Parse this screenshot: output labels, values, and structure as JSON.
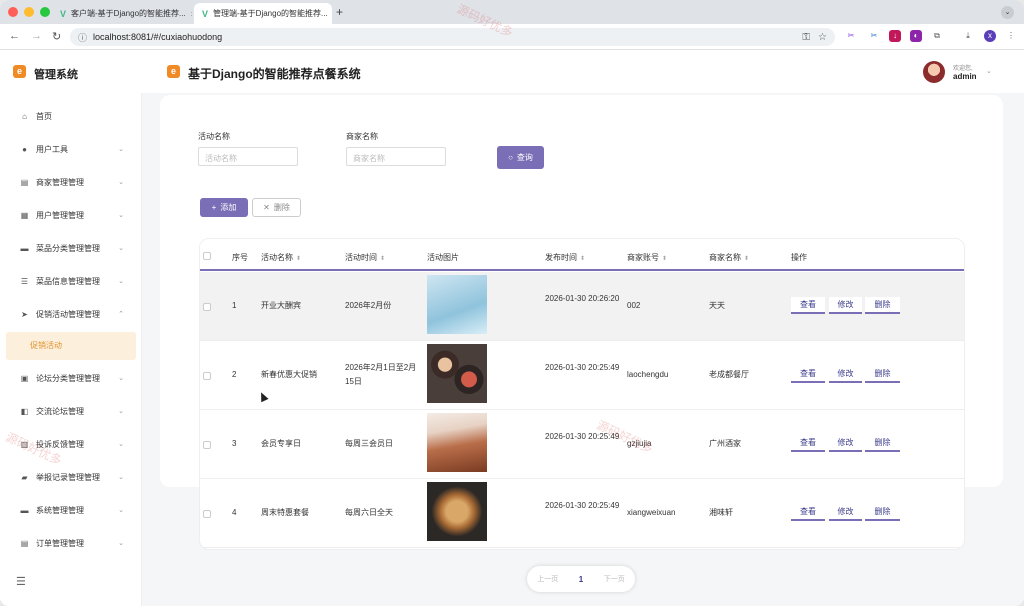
{
  "browser": {
    "tabs": [
      {
        "title": "客户端-基于Django的智能推荐..."
      },
      {
        "title": "管理端-基于Django的智能推荐..."
      }
    ],
    "url": "localhost:8081/#/cuxiaohuodong",
    "profile_initial": "x"
  },
  "header": {
    "brand": "管理系统",
    "title": "基于Django的智能推荐点餐系统",
    "welcome": "欢迎您,",
    "username": "admin"
  },
  "sidebar": {
    "items": [
      {
        "label": "首页",
        "icon": "home-icon",
        "chevron": false
      },
      {
        "label": "用户工具",
        "icon": "user-icon",
        "chevron": true
      },
      {
        "label": "商家管理管理",
        "icon": "shop-icon",
        "chevron": true
      },
      {
        "label": "用户管理管理",
        "icon": "user-manage-icon",
        "chevron": true
      },
      {
        "label": "菜品分类管理管理",
        "icon": "monitor-icon",
        "chevron": true
      },
      {
        "label": "菜品信息管理管理",
        "icon": "sliders-icon",
        "chevron": true
      },
      {
        "label": "促销活动管理管理",
        "icon": "send-icon",
        "chevron": true,
        "expanded": true
      }
    ],
    "subitem": "促销活动",
    "items_after": [
      {
        "label": "论坛分类管理管理",
        "icon": "folder-icon"
      },
      {
        "label": "交流论坛管理",
        "icon": "chat-icon"
      },
      {
        "label": "投诉反馈管理",
        "icon": "feedback-icon"
      },
      {
        "label": "举报记录管理管理",
        "icon": "report-icon"
      },
      {
        "label": "系统管理管理",
        "icon": "system-icon"
      },
      {
        "label": "订单管理管理",
        "icon": "order-icon"
      }
    ]
  },
  "search": {
    "activity_label": "活动名称",
    "activity_placeholder": "活动名称",
    "merchant_label": "商家名称",
    "merchant_placeholder": "商家名称",
    "query_button": "查询"
  },
  "actions": {
    "add": "添加",
    "delete": "删除"
  },
  "table": {
    "headers": [
      "序号",
      "活动名称",
      "活动时间",
      "活动图片",
      "发布时间",
      "商家账号",
      "商家名称",
      "操作"
    ],
    "rows": [
      {
        "no": "1",
        "name": "开业大酬宾",
        "time": "2026年2月份",
        "published": "2026-01-30 20:26:20",
        "account": "002",
        "merchant": "天天"
      },
      {
        "no": "2",
        "name": "新春优惠大促销",
        "time": "2026年2月1日至2月15日",
        "published": "2026-01-30 20:25:49",
        "account": "laochengdu",
        "merchant": "老成都餐厅"
      },
      {
        "no": "3",
        "name": "会员专享日",
        "time": "每周三会员日",
        "published": "2026-01-30 20:25:49",
        "account": "gzjiujia",
        "merchant": "广州酒家"
      },
      {
        "no": "4",
        "name": "周末特惠套餐",
        "time": "每周六日全天",
        "published": "2026-01-30 20:25:49",
        "account": "xiangweixuan",
        "merchant": "湘味轩"
      }
    ],
    "row_actions": {
      "view": "查看",
      "edit": "修改",
      "delete": "删除"
    }
  },
  "pagination": {
    "prev": "上一页",
    "current": "1",
    "next": "下一页"
  },
  "watermark": "源码好优多",
  "colors": {
    "accent": "#7a6fb6",
    "brand": "#f08a24",
    "active_menu_bg": "#fcefdc",
    "active_menu_text": "#e0922e"
  }
}
